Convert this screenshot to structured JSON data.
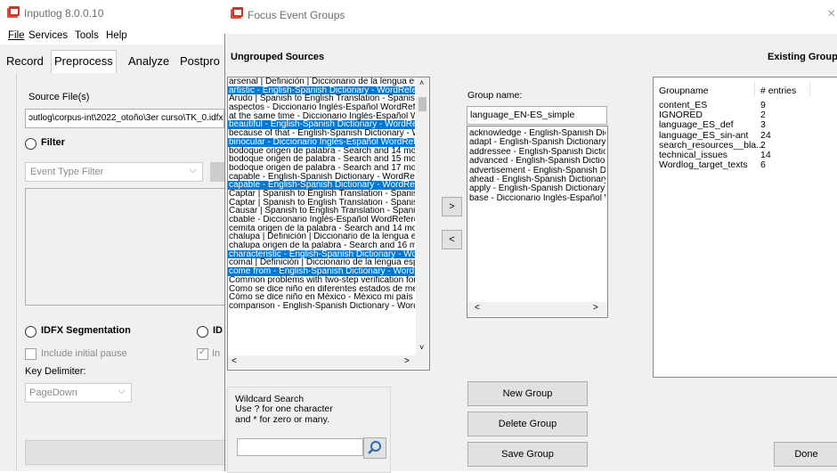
{
  "main_window": {
    "title": "Inputlog 8.0.0.10",
    "menu": [
      "File",
      "Services",
      "Tools",
      "Help"
    ],
    "tabs": [
      "Record",
      "Preprocess",
      "Analyze",
      "Postpro"
    ],
    "active_tab": "Preprocess",
    "source_files_label": "Source File(s)",
    "source_file_value": "ɔutlog\\corpus-int\\2022_otoño\\3er curso\\TK_0.idfx",
    "filter_label": "Filter",
    "event_type_filter_placeholder": "Event Type Filter",
    "idfx_segmentation_label": "IDFX Segmentation",
    "second_radio_label": "ID",
    "include_initial_pause_label": "Include initial pause",
    "second_check_label": "In",
    "key_delimiter_label": "Key Delimiter:",
    "key_delimiter_value": "PageDown"
  },
  "dialog": {
    "title": "Focus Event Groups",
    "close_glyph": "×",
    "ungrouped_sources_label": "Ungrouped Sources",
    "existing_groups_label": "Existing Groups",
    "sources": [
      {
        "text": "arsenal | Definición | Diccionario de la lengua española",
        "selected": false
      },
      {
        "text": "artistic - English-Spanish Dictionary - WordReference",
        "selected": true
      },
      {
        "text": "Arudo | Spanish to English Translation - SpanishDict",
        "selected": false
      },
      {
        "text": "aspectos - Diccionario Inglés-Español WordReference",
        "selected": false
      },
      {
        "text": "at the same time - Diccionario Inglés-Español WordRef",
        "selected": false
      },
      {
        "text": "beautiful - English-Spanish Dictionary - WordReference",
        "selected": true
      },
      {
        "text": "because of that - English-Spanish Dictionary - WordRef",
        "selected": false
      },
      {
        "text": "binocular - Diccionario Inglés-Español WordReference",
        "selected": true
      },
      {
        "text": "bodoque origen de palabra - Search and 14 more pages",
        "selected": false
      },
      {
        "text": "bodoque origen de palabra - Search and 15 more pages",
        "selected": false
      },
      {
        "text": "bodoque origen de palabra - Search and 17 more pages",
        "selected": false
      },
      {
        "text": "capable - English-Spanish Dictionary - WordReference",
        "selected": false
      },
      {
        "text": "capable - English-Spanish Dictionary - WordReference",
        "selected": true
      },
      {
        "text": "Captar | Spanish to English Translation - SpanishDict",
        "selected": false
      },
      {
        "text": "Captar | Spanish to English Translation - SpanishDict",
        "selected": false
      },
      {
        "text": "Causar | Spanish to English Translation - SpanishDict",
        "selected": false
      },
      {
        "text": "cbable - Diccionario Inglés-Español WordReference",
        "selected": false
      },
      {
        "text": "cemita origen de la palabra - Search and 14 more pages",
        "selected": false
      },
      {
        "text": "chalupa | Definición | Diccionario de la lengua española",
        "selected": false
      },
      {
        "text": "chalupa origen de la palabra - Search and 16 more pages",
        "selected": false
      },
      {
        "text": "characteristic - English-Spanish Dictionary - WordReference",
        "selected": true
      },
      {
        "text": "comal | Definición | Diccionario de la lengua española",
        "selected": false
      },
      {
        "text": "come from - English-Spanish Dictionary - WordReference",
        "selected": true
      },
      {
        "text": "Common problems with two-step verification for a work",
        "selected": false
      },
      {
        "text": "Como se dice niño en diferentes estados de mexico",
        "selected": false
      },
      {
        "text": "Cómo se dice niño en México - México mi país arriba",
        "selected": false
      },
      {
        "text": "comparison - English-Spanish Dictionary - WordReference",
        "selected": false
      }
    ],
    "move_right_label": ">",
    "move_left_label": "<",
    "group_name_label": "Group name:",
    "group_name_value": "language_EN-ES_simple",
    "group_members": [
      "acknowledge - English-Spanish Dictionary",
      "adapt - English-Spanish Dictionary - WordRef",
      "addressee - English-Spanish Dictionary",
      "advanced - English-Spanish Dictionary",
      "advertisement - English-Spanish Dictionary",
      "ahead - English-Spanish Dictionary - Word",
      "apply - English-Spanish Dictionary - Word",
      "base - Diccionario Inglés-Español WordRef"
    ],
    "groups_header": {
      "name": "Groupname",
      "entries": "# entries"
    },
    "groups": [
      {
        "name": "content_ES",
        "entries": "9"
      },
      {
        "name": "IGNORED",
        "entries": "2"
      },
      {
        "name": "language_ES_def",
        "entries": "3"
      },
      {
        "name": "language_ES_sin-ant",
        "entries": "24"
      },
      {
        "name": "search_resources__bla...",
        "entries": "2"
      },
      {
        "name": "technical_issues",
        "entries": "14"
      },
      {
        "name": "Wordlog_target_texts",
        "entries": "6"
      }
    ],
    "wildcard_title": "Wildcard Search",
    "wildcard_help_1": "Use ? for one character",
    "wildcard_help_2": "and * for zero or many.",
    "wildcard_value": "",
    "new_group_label": "New Group",
    "delete_group_label": "Delete Group",
    "save_group_label": "Save Group",
    "done_label": "Done"
  },
  "colors": {
    "selection": "#0078d7",
    "window_bg": "#f0f0f0"
  }
}
